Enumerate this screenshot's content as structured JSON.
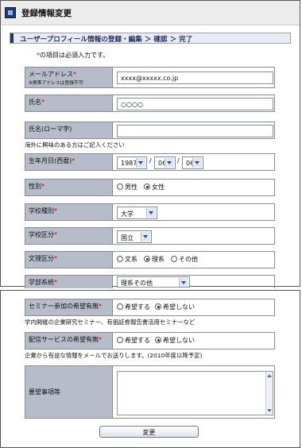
{
  "window_title": "登録情報変更",
  "steps": "ユーザープロフィール情報の登録・編集 ＞ 確認 ＞ 完了",
  "required_note": {
    "mark": "*",
    "text": "の項目は必須入力です。"
  },
  "fields": {
    "email": {
      "label": "メールアドレス",
      "sub": "※携帯アドレスは登録不可",
      "value": "xxxx@xxxxx.co.jp"
    },
    "name": {
      "label": "氏名",
      "value": "○○○○"
    },
    "name_roman": {
      "label": "氏名(ローマ字)",
      "value": "",
      "note": "海外に興味のある方はご記入ください"
    },
    "birthday": {
      "label": "生年月日(西暦)",
      "year": "1987",
      "month": "06",
      "day": "06",
      "sep": "/"
    },
    "gender": {
      "label": "性別",
      "options": [
        "男性",
        "女性"
      ],
      "selected": "女性"
    },
    "school_type": {
      "label": "学校種別",
      "value": "大学"
    },
    "school_div": {
      "label": "学校区分",
      "value": "国立"
    },
    "bunri": {
      "label": "文理区分",
      "options": [
        "文系",
        "理系",
        "その他"
      ],
      "selected": "理系"
    },
    "faculty": {
      "label": "学部系統",
      "value": "理系その他"
    },
    "seminar": {
      "label": "セミナー参加の希望有無",
      "options": [
        "希望する",
        "希望しない"
      ],
      "selected": "希望しない",
      "note": "学内開催の企業研究セミナー、有価証券報告書活用セミナーなど"
    },
    "delivery": {
      "label": "配信サービスの希望有無",
      "options": [
        "希望する",
        "希望しない"
      ],
      "selected": "希望しない",
      "note": "企業から有益な情報をメールでお送りします。(2010年度以降予定)"
    },
    "requests": {
      "label": "要望事項等",
      "value": ""
    }
  },
  "submit_label": "変更"
}
